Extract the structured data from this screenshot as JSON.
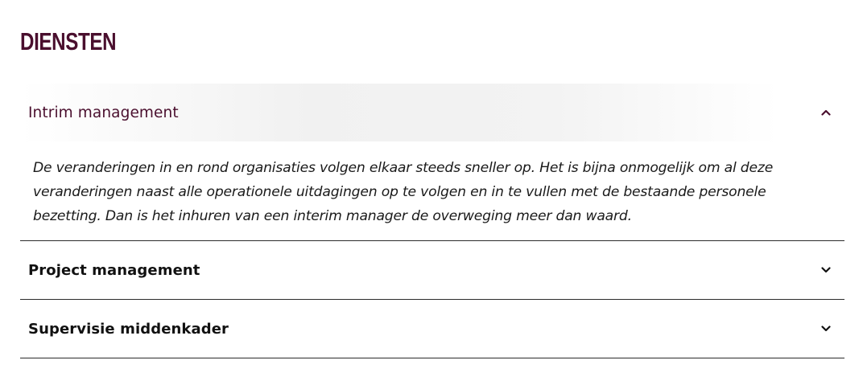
{
  "section": {
    "title": "DIENSTEN"
  },
  "accordion": {
    "items": [
      {
        "label": "Intrim management",
        "state": "expanded",
        "icon": "chevron-up-icon",
        "body": "De veranderingen in en rond organisaties volgen elkaar steeds sneller op. Het is bijna onmogelijk om al deze veranderingen naast alle operationele uitdagingen op te volgen en in te vullen met de bestaande personele bezetting. Dan is het inhuren van een interim manager de overweging meer dan waard."
      },
      {
        "label": "Project management",
        "state": "collapsed",
        "icon": "chevron-down-icon"
      },
      {
        "label": "Supervisie middenkader",
        "state": "collapsed",
        "icon": "chevron-down-icon"
      }
    ]
  },
  "colors": {
    "brand": "#4a0f2e",
    "text": "#111111",
    "divider": "#2b2b2b",
    "header_bg": "#f2f2f2"
  }
}
